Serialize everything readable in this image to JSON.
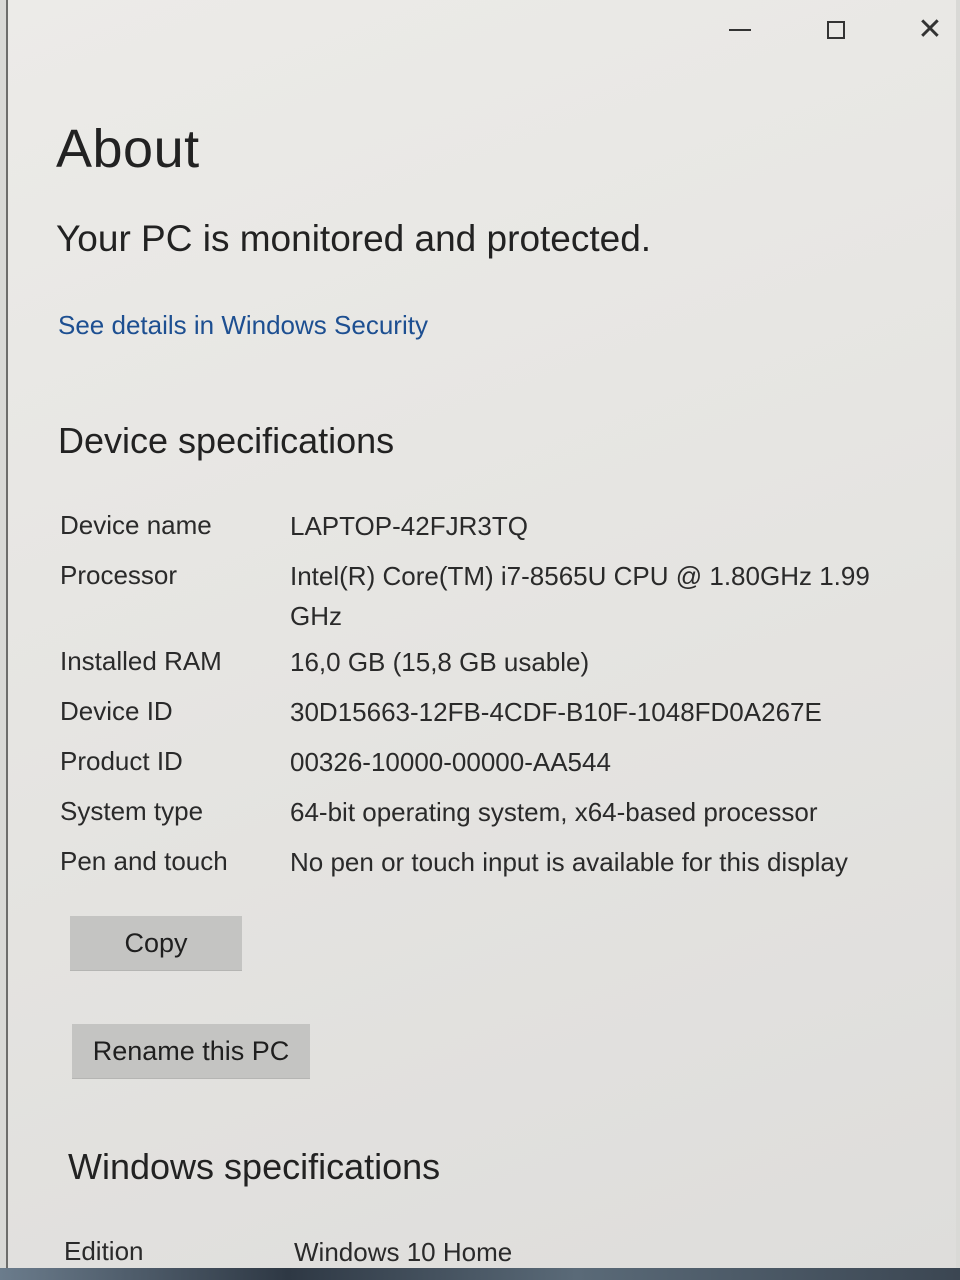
{
  "window": {
    "controls": {
      "minimize_icon": "minimize-icon",
      "maximize_icon": "maximize-icon",
      "close_icon": "close-icon",
      "close_glyph": "✕"
    }
  },
  "page": {
    "title": "About",
    "protection_status": "Your PC is monitored and protected.",
    "security_link": "See details in Windows Security"
  },
  "device_specs": {
    "heading": "Device specifications",
    "rows": [
      {
        "label": "Device name",
        "value": "LAPTOP-42FJR3TQ"
      },
      {
        "label": "Processor",
        "value": "Intel(R) Core(TM) i7-8565U CPU @ 1.80GHz   1.99 GHz"
      },
      {
        "label": "Installed RAM",
        "value": "16,0 GB (15,8 GB usable)"
      },
      {
        "label": "Device ID",
        "value": "30D15663-12FB-4CDF-B10F-1048FD0A267E"
      },
      {
        "label": "Product ID",
        "value": "00326-10000-00000-AA544"
      },
      {
        "label": "System type",
        "value": "64-bit operating system, x64-based processor"
      },
      {
        "label": "Pen and touch",
        "value": "No pen or touch input is available for this display"
      }
    ],
    "copy_button": "Copy",
    "rename_button": "Rename this PC"
  },
  "windows_specs": {
    "heading": "Windows specifications",
    "rows": [
      {
        "label": "Edition",
        "value": "Windows 10 Home"
      }
    ]
  },
  "colors": {
    "link": "#1d4f91",
    "button_bg": "#c4c4c2",
    "window_bg": "#e8e7e4"
  }
}
